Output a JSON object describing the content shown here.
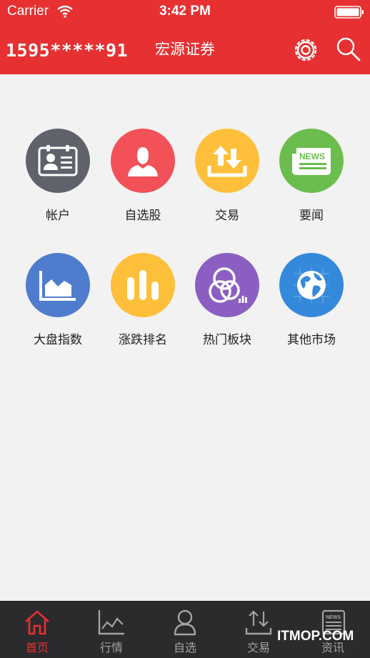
{
  "status_bar": {
    "carrier": "Carrier",
    "time": "3:42 PM"
  },
  "header": {
    "account": "1595*****91",
    "title": "宏源证券"
  },
  "colors": {
    "brand_red": "#e63032",
    "account_gray": "#5f616b",
    "watchlist_red": "#f25157",
    "trade_yellow": "#fec03a",
    "news_green": "#6bbd4d",
    "index_blue": "#4f7ccd",
    "ranking_yellow": "#fec03a",
    "sector_purple": "#8b5fc2",
    "market_blue": "#3489da"
  },
  "grid": {
    "items": [
      {
        "label": "帐户",
        "icon": "account-card-icon"
      },
      {
        "label": "自选股",
        "icon": "person-icon"
      },
      {
        "label": "交易",
        "icon": "trade-arrows-icon"
      },
      {
        "label": "要闻",
        "icon": "news-icon"
      },
      {
        "label": "大盘指数",
        "icon": "area-chart-icon"
      },
      {
        "label": "涨跌排名",
        "icon": "bar-chart-icon"
      },
      {
        "label": "热门板块",
        "icon": "sector-icon"
      },
      {
        "label": "其他市场",
        "icon": "globe-icon"
      }
    ]
  },
  "tabbar": {
    "tabs": [
      {
        "label": "首页",
        "icon": "home-icon",
        "active": true
      },
      {
        "label": "行情",
        "icon": "line-chart-icon"
      },
      {
        "label": "自选",
        "icon": "user-icon"
      },
      {
        "label": "交易",
        "icon": "transfer-icon"
      },
      {
        "label": "资讯",
        "icon": "news-icon"
      }
    ]
  },
  "watermark": "ITMOP.COM"
}
